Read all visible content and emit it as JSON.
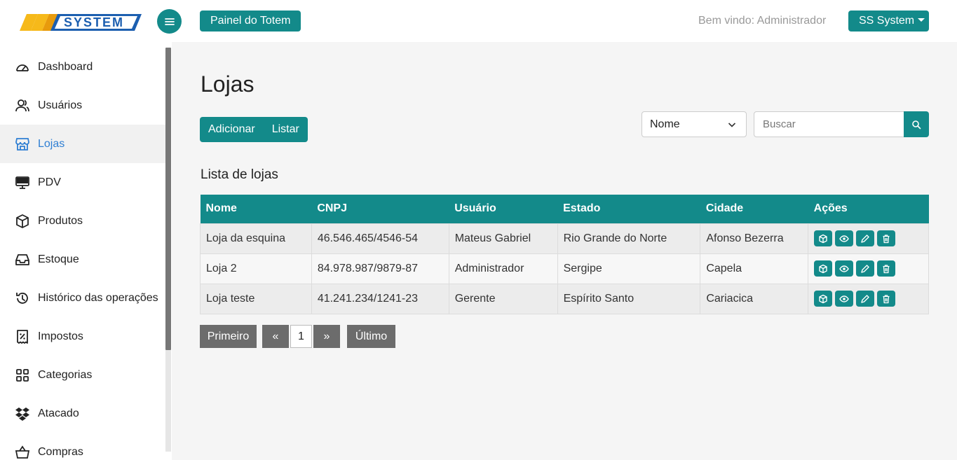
{
  "header": {
    "logo_text": "SYSTEM",
    "totem_button": "Painel do Totem",
    "welcome_text": "Bem vindo: Administrador",
    "user_menu": "SS System"
  },
  "sidebar": {
    "items": [
      {
        "label": "Dashboard",
        "icon": "speedometer-icon",
        "active": false
      },
      {
        "label": "Usuários",
        "icon": "users-icon",
        "active": false
      },
      {
        "label": "Lojas",
        "icon": "store-icon",
        "active": true
      },
      {
        "label": "PDV",
        "icon": "monitor-icon",
        "active": false
      },
      {
        "label": "Produtos",
        "icon": "box-icon",
        "active": false
      },
      {
        "label": "Estoque",
        "icon": "inbox-icon",
        "active": false
      },
      {
        "label": "Histórico das operações",
        "icon": "history-icon",
        "active": false
      },
      {
        "label": "Impostos",
        "icon": "receipt-percent-icon",
        "active": false
      },
      {
        "label": "Categorias",
        "icon": "grid-icon",
        "active": false
      },
      {
        "label": "Atacado",
        "icon": "dropbox-icon",
        "active": false
      },
      {
        "label": "Compras",
        "icon": "basket-icon",
        "active": false
      }
    ]
  },
  "main": {
    "title": "Lojas",
    "add_button": "Adicionar",
    "list_button": "Listar",
    "filter_select": "Nome",
    "search_placeholder": "Buscar",
    "section_title": "Lista de lojas",
    "table": {
      "headers": [
        "Nome",
        "CNPJ",
        "Usuário",
        "Estado",
        "Cidade",
        "Ações"
      ],
      "rows": [
        [
          "Loja da esquina",
          "46.546.465/4546-54",
          "Mateus Gabriel",
          "Rio Grande do Norte",
          "Afonso Bezerra"
        ],
        [
          "Loja 2",
          "84.978.987/9879-87",
          "Administrador",
          "Sergipe",
          "Capela"
        ],
        [
          "Loja teste",
          "41.241.234/1241-23",
          "Gerente",
          "Espírito Santo",
          "Cariacica"
        ]
      ]
    },
    "pagination": {
      "first": "Primeiro",
      "prev": "«",
      "page": "1",
      "next": "»",
      "last": "Último"
    }
  },
  "colors": {
    "accent": "#138a8a",
    "active_link": "#2f7fd3"
  }
}
